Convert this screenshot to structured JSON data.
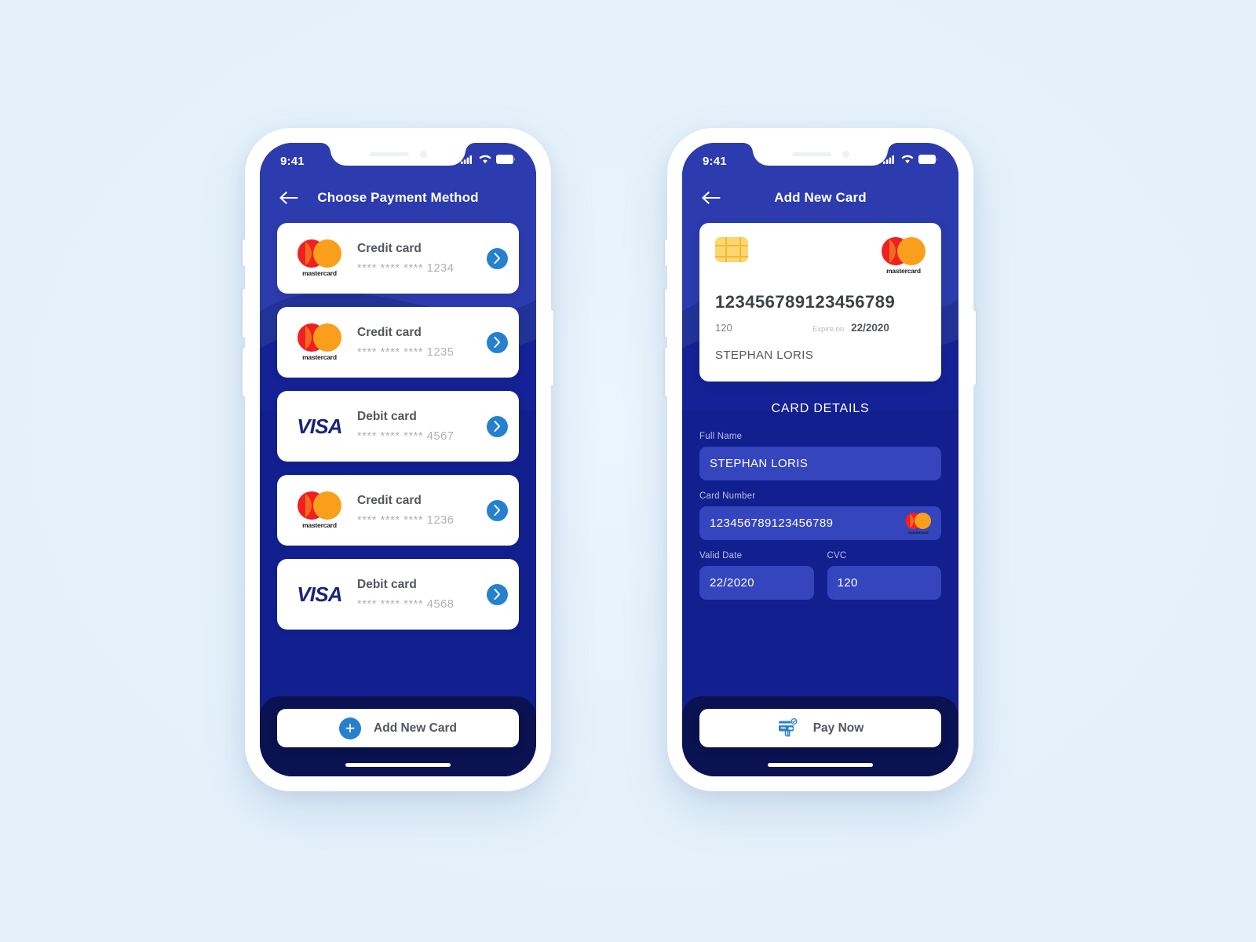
{
  "theme": {
    "page_bg": "#e8f4fc",
    "screen_blue": "#121f8f",
    "screen_blue_dark": "#101f8c",
    "bottom_bar": "#0a1252",
    "accent_blue": "#2680cd",
    "field_blue": "#3445bd",
    "mastercard_red": "#f02020",
    "mastercard_orange": "#f99f1b",
    "visa_blue": "#1a237e",
    "chip_yellow": "#fcd770"
  },
  "phone1": {
    "status": {
      "time": "9:41",
      "signal_icon": "cellular-signal-icon",
      "wifi_icon": "wifi-icon",
      "battery_icon": "battery-icon"
    },
    "header": {
      "back_icon": "back-arrow-icon",
      "title": "Choose Payment Method"
    },
    "methods": [
      {
        "brand": "mastercard",
        "brand_word": "mastercard",
        "title": "Credit card",
        "number": "**** **** **** 1234",
        "chevron_icon": "chevron-right-icon"
      },
      {
        "brand": "mastercard",
        "brand_word": "mastercard",
        "title": "Credit card",
        "number": "**** **** **** 1235",
        "chevron_icon": "chevron-right-icon"
      },
      {
        "brand": "visa",
        "brand_word": "VISA",
        "title": "Debit card",
        "number": "**** **** **** 4567",
        "chevron_icon": "chevron-right-icon"
      },
      {
        "brand": "mastercard",
        "brand_word": "mastercard",
        "title": "Credit card",
        "number": "**** **** **** 1236",
        "chevron_icon": "chevron-right-icon"
      },
      {
        "brand": "visa",
        "brand_word": "VISA",
        "title": "Debit card",
        "number": "**** **** **** 4568",
        "chevron_icon": "chevron-right-icon"
      }
    ],
    "bottom_action": {
      "icon": "plus-circle-icon",
      "plus_glyph": "+",
      "label": "Add New Card"
    }
  },
  "phone2": {
    "status": {
      "time": "9:41",
      "signal_icon": "cellular-signal-icon",
      "wifi_icon": "wifi-icon",
      "battery_icon": "battery-icon"
    },
    "header": {
      "back_icon": "back-arrow-icon",
      "title": "Add New Card"
    },
    "card_preview": {
      "chip_icon": "emv-chip-icon",
      "brand_icon": "mastercard-logo",
      "brand_word": "mastercard",
      "number": "123456789123456789",
      "cvc": "120",
      "expire_label": "Expire on",
      "expire_value": "22/2020",
      "holder_name": "STEPHAN LORIS"
    },
    "form": {
      "section_title": "CARD DETAILS",
      "fields": [
        {
          "label": "Full Name",
          "value": "STEPHAN LORIS",
          "has_brand": false
        },
        {
          "label": "Card Number",
          "value": "123456789123456789",
          "has_brand": true,
          "brand_icon": "mastercard-logo",
          "brand_word": "mastercard"
        }
      ],
      "row_fields": [
        {
          "label": "Valid Date",
          "value": "22/2020"
        },
        {
          "label": "CVC",
          "value": "120"
        }
      ]
    },
    "bottom_action": {
      "icon": "card-tap-pay-icon",
      "label": "Pay Now"
    }
  }
}
